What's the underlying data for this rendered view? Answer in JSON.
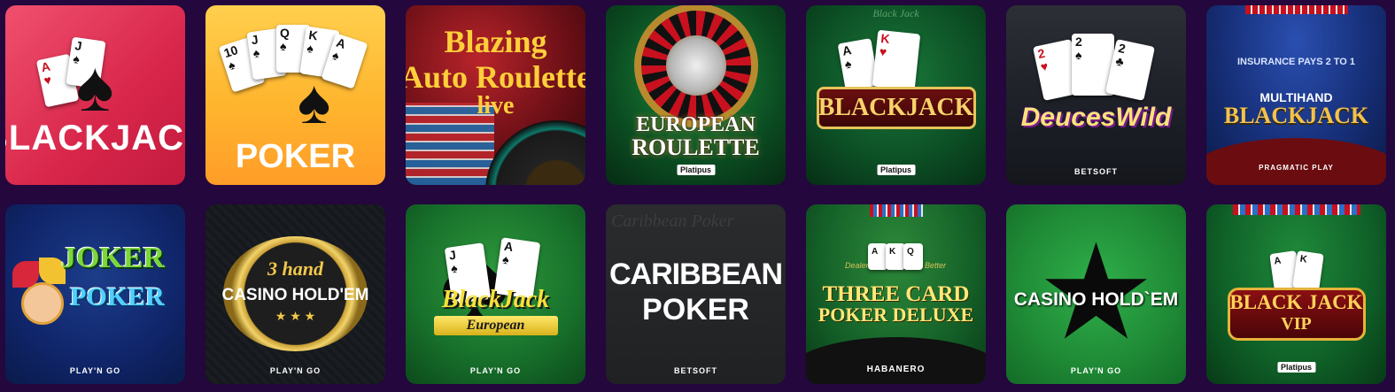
{
  "tiles": {
    "blackjack": {
      "title": "BLACKJACK"
    },
    "poker": {
      "title": "POKER",
      "cards": [
        "10",
        "J",
        "Q",
        "K",
        "A"
      ]
    },
    "blazing": {
      "line1": "Blazing",
      "line2": "Auto Roulette",
      "line3": "live"
    },
    "european_roulette": {
      "line1": "EUROPEAN",
      "line2": "ROULETTE",
      "provider": "Platipus"
    },
    "blackjack_platipus": {
      "title": "BLACKJACK",
      "provider": "Platipus",
      "table": "Black Jack"
    },
    "deuces_wild": {
      "title": "DeucesWild",
      "provider": "BETSOFT",
      "cards": [
        "2",
        "2",
        "2"
      ]
    },
    "multihand": {
      "line1": "MULTIHAND",
      "line2": "BLACKJACK",
      "provider": "PRAGMATIC PLAY",
      "felt": "INSURANCE PAYS 2 TO 1"
    },
    "joker_poker": {
      "line1": "JOKER",
      "line2": "POKER",
      "provider": "PLAY'N GO"
    },
    "three_hand": {
      "line1": "3 hand",
      "line2": "CASINO HOLD'EM",
      "provider": "PLAY'N GO"
    },
    "blackjack_european": {
      "line1": "BlackJack",
      "line2": "European",
      "provider": "PLAY'N GO"
    },
    "caribbean": {
      "line1": "CARIBBEAN",
      "line2": "POKER",
      "provider": "BETSOFT",
      "bg_text": "Caribbean Poker"
    },
    "three_card": {
      "line1": "THREE CARD",
      "line2": "POKER DELUXE",
      "provider": "HABANERO",
      "felt_left": "Dealer",
      "felt_right": "Better"
    },
    "casino_holdem": {
      "title": "CASINO HOLD`EM",
      "provider": "PLAY'N GO"
    },
    "blackjack_vip": {
      "line1": "BLACK JACK",
      "line2": "VIP",
      "provider": "Platipus"
    }
  },
  "colors": {
    "page_bg": "#23073d",
    "gold": "#f2c94c",
    "felt_green": "#0f6b3a"
  }
}
